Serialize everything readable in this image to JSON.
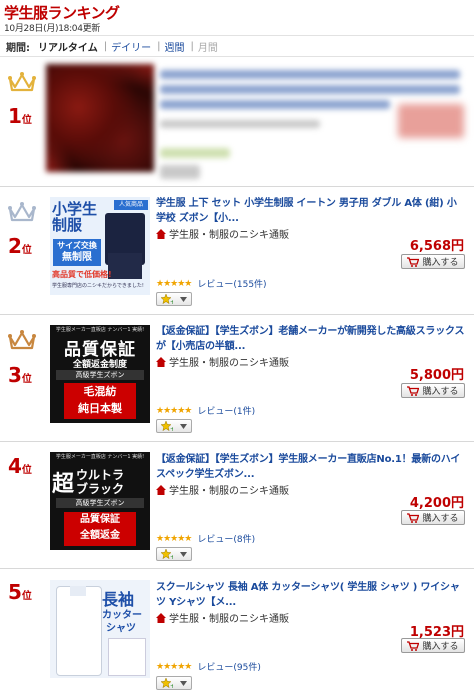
{
  "header": {
    "title": "学生服ランキング",
    "updated": "10月28日(月)18:04更新"
  },
  "period": {
    "label": "期間:",
    "tabs": [
      {
        "label": "リアルタイム",
        "state": "active"
      },
      {
        "label": "デイリー",
        "state": "link"
      },
      {
        "label": "週間",
        "state": "link"
      },
      {
        "label": "月間",
        "state": "disabled"
      }
    ],
    "separator": "|"
  },
  "colors": {
    "accent_red": "#bf0000",
    "link_blue": "#1a4a9c",
    "crown_gold": "#e3b23c",
    "crown_silver": "#a9b7cc",
    "crown_bronze": "#c8873f",
    "star_gold": "#f0a400"
  },
  "rank_suffix": "位",
  "cart_label": "購入する",
  "review_prefix": "レビュー",
  "items": [
    {
      "rank": "1",
      "crown": "gold",
      "blurred": true
    },
    {
      "rank": "2",
      "crown": "silver",
      "name": "学生服 上下 セット 小学生制服 イートン 男子用 ダブル A体 (紺) 小学校 ズボン【小...",
      "shop": "学生服・制服のニシキ通販",
      "price": "6,568円",
      "stars": "★★★★★",
      "rating": 4.5,
      "reviews": "(155件)",
      "thumb_text": [
        "小学生",
        "制服",
        "人気商品",
        "サイズ交換",
        "無制限",
        "高品質で低価格!",
        "学生服専門店のニシキだからできました!"
      ]
    },
    {
      "rank": "3",
      "crown": "bronze",
      "name": "【返金保証】【学生ズボン】老舗メーカーが新開発した高級スラックスが【小売店の半額...",
      "shop": "学生服・制服のニシキ通販",
      "price": "5,800円",
      "stars": "★★★★★",
      "rating": 5,
      "reviews": "(1件)",
      "thumb_text": [
        "学生服メーカー直販店 ナンバー1 実績!",
        "品質保証",
        "全額返金制度",
        "高級学生ズボン",
        "毛混紡",
        "純日本製"
      ]
    },
    {
      "rank": "4",
      "crown": "none",
      "name": "【返金保証】【学生ズボン】学生服メーカー直販店No.1！最新のハイスペック学生ズボン...",
      "shop": "学生服・制服のニシキ通販",
      "price": "4,200円",
      "stars": "★★★★★",
      "rating": 4.5,
      "reviews": "(8件)",
      "thumb_text": [
        "学生服メーカー直販店 ナンバー1 実績!",
        "超",
        "ウルトラ",
        "ブラック",
        "高級学生ズボン",
        "品質保証",
        "全額返金"
      ]
    },
    {
      "rank": "5",
      "crown": "none",
      "name": "スクールシャツ 長袖 A体 カッターシャツ( 学生服 シャツ ) ワイシャツ Yシャツ【メ...",
      "shop": "学生服・制服のニシキ通販",
      "price": "1,523円",
      "stars": "★★★★★",
      "rating": 4.5,
      "reviews": "(95件)",
      "thumb_text": [
        "長袖",
        "カッター",
        "シャツ"
      ]
    }
  ]
}
